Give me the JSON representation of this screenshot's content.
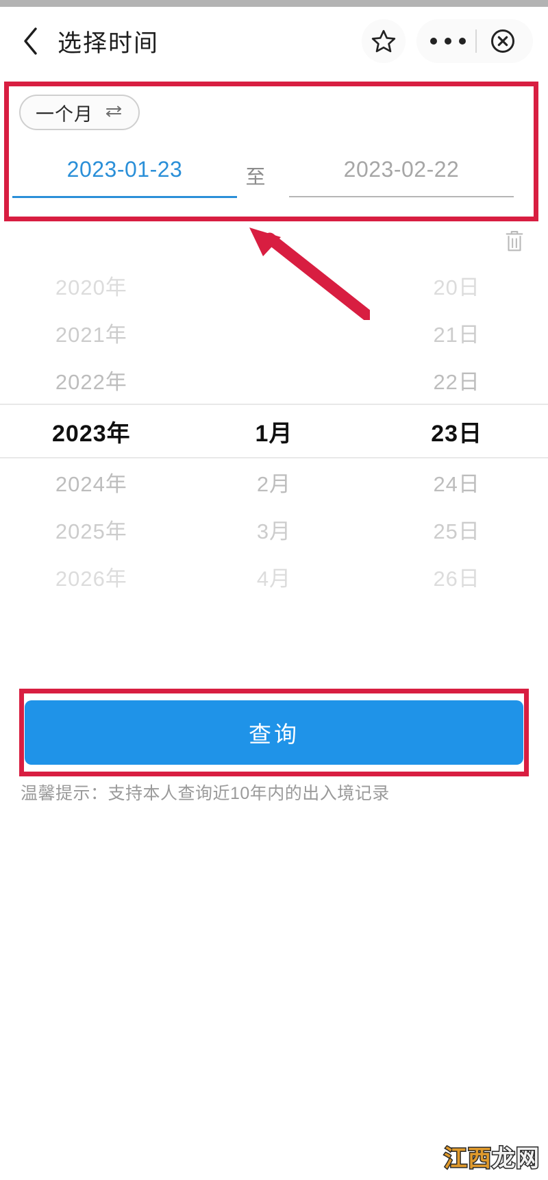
{
  "header": {
    "back_icon": "back-chevron-icon",
    "title": "选择时间",
    "star_icon": "star-outline-icon",
    "more_icon": "more-dots-icon",
    "close_icon": "circle-close-icon"
  },
  "range": {
    "quick_select_label": "一个月",
    "swap_icon": "swap-arrows-icon",
    "start_date": "2023-01-23",
    "separator": "至",
    "end_date": "2023-02-22",
    "trash_icon": "trash-can-icon",
    "active_color": "#2a8fd8",
    "inactive_color": "#a6a6a6"
  },
  "picker": {
    "columns": [
      "年",
      "月",
      "日"
    ],
    "rows": [
      {
        "year": "2020年",
        "month": "",
        "day": "20日",
        "state": "dim3"
      },
      {
        "year": "2021年",
        "month": "",
        "day": "21日",
        "state": "dim2"
      },
      {
        "year": "2022年",
        "month": "",
        "day": "22日",
        "state": "dim1"
      },
      {
        "year": "2023年",
        "month": "1月",
        "day": "23日",
        "state": "selected"
      },
      {
        "year": "2024年",
        "month": "2月",
        "day": "24日",
        "state": "dim1"
      },
      {
        "year": "2025年",
        "month": "3月",
        "day": "25日",
        "state": "dim2"
      },
      {
        "year": "2026年",
        "month": "4月",
        "day": "26日",
        "state": "dim3"
      }
    ],
    "selected": {
      "year": "2023年",
      "month": "1月",
      "day": "23日"
    }
  },
  "actions": {
    "query_label": "查询",
    "query_color": "#1f93e8"
  },
  "tip": {
    "text": "温馨提示：支持本人查询近10年内的出入境记录"
  },
  "watermark": {
    "part1": "江西",
    "part2": "龙网"
  },
  "annotations": {
    "color": "#d81e41",
    "box_date_label": "date-range-highlight",
    "box_query_label": "query-button-highlight",
    "arrow_label": "pointer-arrow"
  }
}
